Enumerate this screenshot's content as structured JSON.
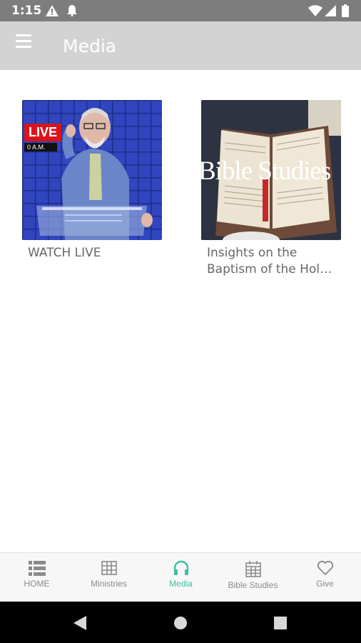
{
  "status_bar": {
    "time": "1:15"
  },
  "app_bar": {
    "title": "Media"
  },
  "media_items": [
    {
      "title": "WATCH LIVE",
      "thumb_badge": "LIVE",
      "thumb_caption": "0 A.M."
    },
    {
      "title": "Insights on the Baptism of the Hol…",
      "thumb_text": "Bible Studies"
    }
  ],
  "bottom_nav": [
    {
      "label": "HOME",
      "icon": "list-icon"
    },
    {
      "label": "Ministries",
      "icon": "grid-icon"
    },
    {
      "label": "Media",
      "icon": "headphones-icon",
      "active": true
    },
    {
      "label": "Bible Studies",
      "icon": "calendar-icon"
    },
    {
      "label": "Give",
      "icon": "heart-icon"
    }
  ],
  "colors": {
    "app_bar": "#d3d3d3",
    "active": "#3bbfa3",
    "status_bar": "#7d7d7d"
  }
}
